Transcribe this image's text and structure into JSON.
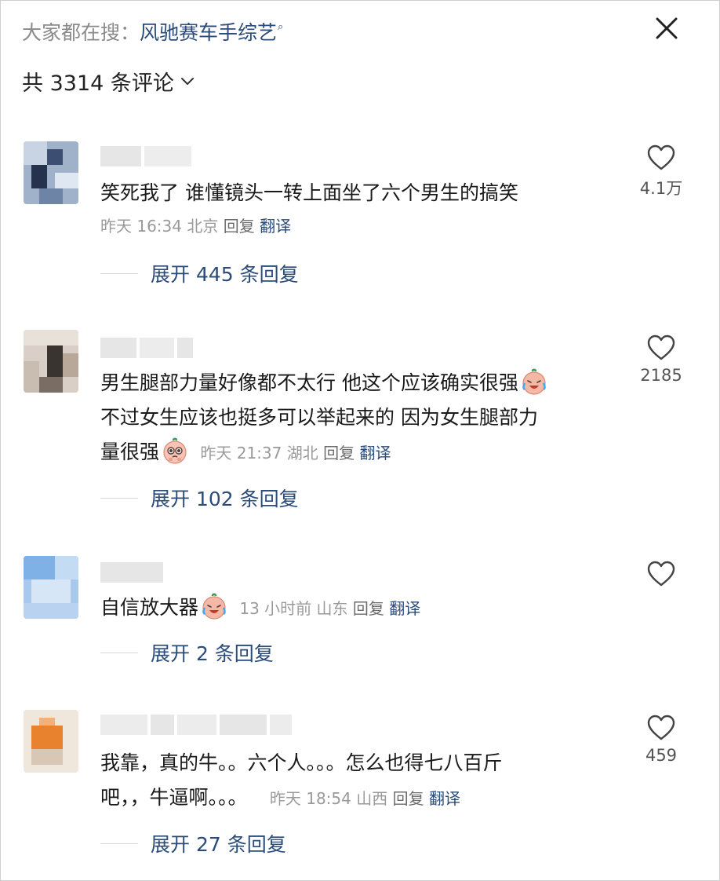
{
  "header": {
    "search_prefix": "大家都在搜：",
    "search_term": "风驰赛车手综艺",
    "comment_count": "共 3314 条评论"
  },
  "comments": [
    {
      "text": "笑死我了 谁懂镜头一转上面坐了六个男生的搞笑",
      "time": "昨天 16:34",
      "location": "北京",
      "reply_label": "回复",
      "translate_label": "翻译",
      "likes": "4.1万",
      "expand_label": "展开 445 条回复"
    },
    {
      "text_line1": "男生腿部力量好像都不太行 他这个应该确实很强",
      "text_line2": "不过女生应该也挺多可以举起来的 因为女生腿部力",
      "text_line3": "量很强",
      "time": "昨天 21:37",
      "location": "湖北",
      "reply_label": "回复",
      "translate_label": "翻译",
      "likes": "2185",
      "expand_label": "展开 102 条回复"
    },
    {
      "text": "自信放大器",
      "time": "13 小时前",
      "location": "山东",
      "reply_label": "回复",
      "translate_label": "翻译",
      "likes": "",
      "expand_label": "展开 2 条回复"
    },
    {
      "text_line1": "我靠，真的牛。。六个人。。。怎么也得七八百斤",
      "text_line2": "吧，，牛逼啊。。。",
      "time": "昨天 18:54",
      "location": "山西",
      "reply_label": "回复",
      "translate_label": "翻译",
      "likes": "459",
      "expand_label": "展开 27 条回复"
    }
  ],
  "icons": {
    "close": "close-icon",
    "chevron": "chevron-down-icon",
    "search": "search-icon",
    "like": "heart-icon",
    "emoji_crying": "crying-laughing-emoji",
    "emoji_pleading": "pleading-emoji"
  },
  "colors": {
    "link": "#2b4b78",
    "muted": "#9a9a9a",
    "text": "#1a1a1a"
  }
}
